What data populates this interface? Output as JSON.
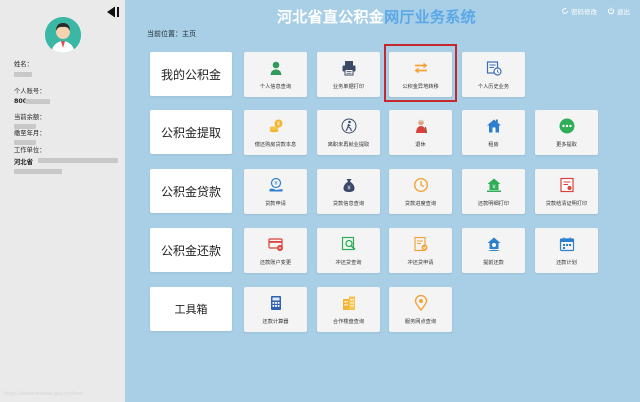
{
  "app": {
    "title_main": "河北省直公积金",
    "title_accent": "网厅业务系统",
    "top_buttons": [
      {
        "label": "密码修改",
        "icon": "refresh-icon"
      },
      {
        "label": "退出",
        "icon": "power-icon"
      }
    ]
  },
  "breadcrumb": "当前位置：主页",
  "sidebar": {
    "fields": [
      {
        "label": "姓名：",
        "value": ""
      },
      {
        "label": "个人账号：",
        "value": "800"
      },
      {
        "label": "当前余额：",
        "value": ""
      },
      {
        "label": "缴至年月：",
        "value": ""
      },
      {
        "label": "工作单位：",
        "value": "河北省"
      }
    ],
    "url_text": "https://www.ehebei.gov.cn/fund"
  },
  "categories": [
    {
      "label": "我的公积金",
      "tiles": [
        {
          "label": "个人信息查询",
          "icon": "person-icon"
        },
        {
          "label": "业务单据打印",
          "icon": "printer-icon"
        },
        {
          "label": "公积金异地转移",
          "icon": "transfer-icon"
        },
        {
          "label": "个人历史业务",
          "icon": "history-icon"
        }
      ]
    },
    {
      "label": "公积金提取",
      "tiles": [
        {
          "label": "偿还购房贷款本息",
          "icon": "coins-icon"
        },
        {
          "label": "离职未再就业提取",
          "icon": "walking-person-icon"
        },
        {
          "label": "退休",
          "icon": "retiree-icon"
        },
        {
          "label": "租房",
          "icon": "rent-house-icon"
        },
        {
          "label": "更多提取",
          "icon": "more-icon"
        }
      ]
    },
    {
      "label": "公积金贷款",
      "tiles": [
        {
          "label": "贷款申请",
          "icon": "loan-hand-icon"
        },
        {
          "label": "贷款信息查询",
          "icon": "money-bag-icon"
        },
        {
          "label": "贷款进度查询",
          "icon": "progress-clock-icon"
        },
        {
          "label": "还款明细打印",
          "icon": "house-money-icon"
        },
        {
          "label": "贷款结清证明打印",
          "icon": "certificate-icon"
        }
      ]
    },
    {
      "label": "公积金还款",
      "tiles": [
        {
          "label": "还款账户变更",
          "icon": "card-change-icon"
        },
        {
          "label": "冲还贷查询",
          "icon": "search-doc-icon"
        },
        {
          "label": "冲还贷申请",
          "icon": "apply-doc-icon"
        },
        {
          "label": "提前还款",
          "icon": "early-repay-icon"
        },
        {
          "label": "还款计划",
          "icon": "calendar-icon"
        }
      ]
    },
    {
      "label": "工具箱",
      "tiles": [
        {
          "label": "还款计算器",
          "icon": "calculator-icon"
        },
        {
          "label": "合作楼盘查询",
          "icon": "building-icon"
        },
        {
          "label": "服务网点查询",
          "icon": "location-pin-icon"
        }
      ]
    }
  ]
}
